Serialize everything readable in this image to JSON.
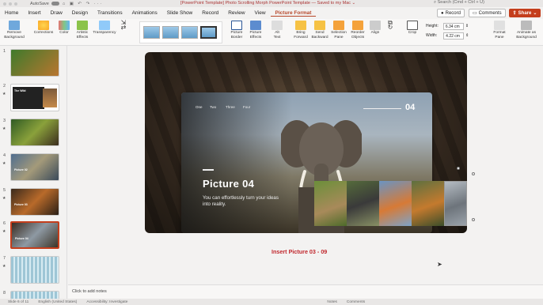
{
  "titlebar": {
    "autosave_label": "AutoSave",
    "quick_access": "⌂ ▣ ↶ ↷ ··· ",
    "document_title": "[PowerPoint Template] Photo Scrolling Morph PowerPoint Template — Saved to my Mac ⌄",
    "search_placeholder": "Search (Cmd + Ctrl + U)"
  },
  "tabs": [
    {
      "label": "Home"
    },
    {
      "label": "Insert"
    },
    {
      "label": "Draw"
    },
    {
      "label": "Design"
    },
    {
      "label": "Transitions"
    },
    {
      "label": "Animations"
    },
    {
      "label": "Slide Show"
    },
    {
      "label": "Record"
    },
    {
      "label": "Review"
    },
    {
      "label": "View"
    },
    {
      "label": "Picture Format"
    }
  ],
  "header_buttons": {
    "record": "Record",
    "comments": "Comments",
    "share": "Share"
  },
  "ribbon": {
    "remove_background": "Remove\nBackground",
    "corrections": "Corrections",
    "color": "Color",
    "artistic_effects": "Artistic\nEffects",
    "transparency": "Transparency",
    "picture_border": "Picture\nBorder",
    "picture_effects": "Picture\nEffects",
    "alt_text": "Alt\nText",
    "bring_forward": "Bring\nForward",
    "send_backward": "Send\nBackward",
    "selection_pane": "Selection\nPane",
    "reorder_objects": "Reorder\nObjects",
    "align": "Align",
    "crop": "Crop",
    "height_label": "Height:",
    "height_value": "6.34 cm",
    "width_label": "Width:",
    "width_value": "4.22 cm",
    "format_pane": "Format\nPane",
    "animate_as_background": "Animate as\nBackground"
  },
  "slides": [
    {
      "num": "1",
      "caption": ""
    },
    {
      "num": "2",
      "caption": "The Wild"
    },
    {
      "num": "3",
      "caption": ""
    },
    {
      "num": "4",
      "caption": "Picture 02"
    },
    {
      "num": "5",
      "caption": "Picture 03"
    },
    {
      "num": "6",
      "caption": "Picture 04"
    },
    {
      "num": "7",
      "caption": ""
    },
    {
      "num": "8",
      "caption": ""
    }
  ],
  "slide_content": {
    "nav_items": [
      "One",
      "Two",
      "Three",
      "Four"
    ],
    "number": "04",
    "heading": "Picture 04",
    "subtitle": "You can effortlessly turn your ideas into reality."
  },
  "insert_label": "Insert Picture 03 - 09",
  "notes_placeholder": "Click to add notes",
  "status": {
    "slide": "Slide 6 of 11",
    "language": "English (United States)",
    "accessibility": "Accessibility: Investigate",
    "notes": "Notes",
    "comments": "Comments"
  },
  "colors": {
    "accent": "#c43e1c",
    "insert_label": "#c0272d"
  }
}
